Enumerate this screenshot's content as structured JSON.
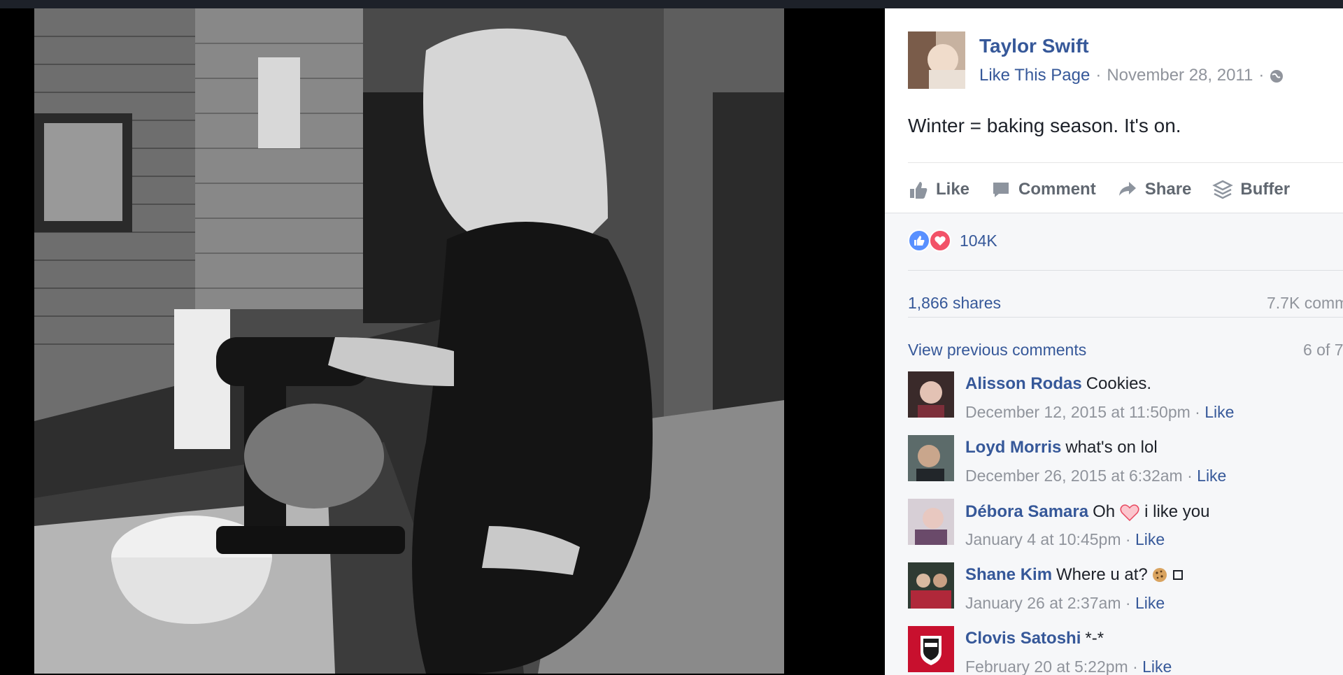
{
  "post": {
    "page_name": "Taylor Swift",
    "like_page": "Like This Page",
    "separator": "·",
    "date": "November 28, 2011",
    "globe_icon": "globe-icon",
    "text": "Winter = baking season. It's on."
  },
  "actions": {
    "like": "Like",
    "comment": "Comment",
    "share": "Share",
    "buffer": "Buffer"
  },
  "reactions": {
    "count": "104K"
  },
  "stats": {
    "shares": "1,866 shares",
    "comments": "7.7K comm"
  },
  "comments_nav": {
    "view_previous": "View previous comments",
    "page_count": "6 of 7"
  },
  "comments": [
    {
      "author": "Alisson Rodas",
      "text": "Cookies.",
      "time": "December 12, 2015 at 11:50pm",
      "like": "Like"
    },
    {
      "author": "Loyd Morris",
      "text": "what's on lol",
      "time": "December 26, 2015 at 6:32am",
      "like": "Like"
    },
    {
      "author": "Débora Samara",
      "text_before": "Oh",
      "text_after": "i like you",
      "time": "January 4 at 10:45pm",
      "like": "Like"
    },
    {
      "author": "Shane Kim",
      "text": "Where u at?",
      "time": "January 26 at 2:37am",
      "like": "Like"
    },
    {
      "author": "Clovis Satoshi",
      "text": "*-*",
      "time": "February 20 at 5:22pm",
      "like": "Like"
    }
  ],
  "colors": {
    "link": "#365899",
    "muted": "#90949c",
    "text": "#1d2129",
    "like_reaction": "#5890ff",
    "love_reaction": "#f25268"
  }
}
